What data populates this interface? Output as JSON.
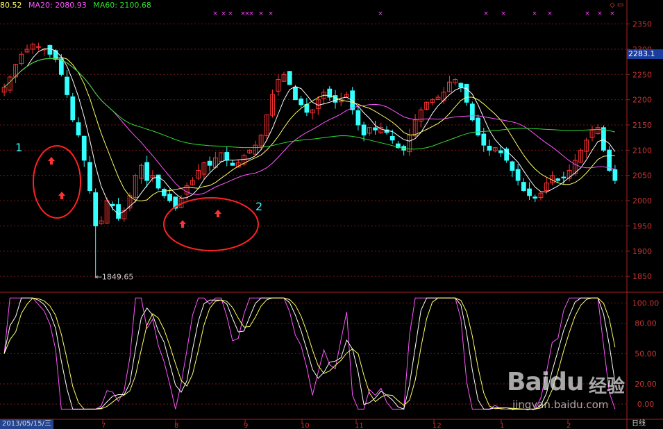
{
  "header": {
    "ma_items": [
      {
        "label": "80.52",
        "color": "#ffff66"
      },
      {
        "label": "MA20: 2080.93",
        "color": "#ff55ff"
      },
      {
        "label": "MA60: 2100.68",
        "color": "#33dd33"
      }
    ],
    "current_price": "2283.1",
    "corner_icons": "◇ ▭"
  },
  "footer": {
    "date_label": "2013/05/15/三",
    "period_label": "日线"
  },
  "annotations": {
    "label_1": "1",
    "label_2": "2",
    "low_label": "←1849.65"
  },
  "watermark": {
    "logo": "Baidu",
    "cn": "经验",
    "url": "jingyan.baidu.com"
  },
  "chart_data": [
    {
      "type": "candlestick",
      "y_ticks": [
        2350,
        2300,
        2250,
        2200,
        2150,
        2100,
        2050,
        2000,
        1950,
        1900,
        1850
      ],
      "y_tick_labels": [
        "2350",
        "2300",
        "2250",
        "2200",
        "2150",
        "2100",
        "2050",
        "2000",
        "1950",
        "1900",
        "1850"
      ],
      "ylim": [
        1820,
        2370
      ],
      "x_tick_labels": [
        "7",
        "8",
        "9",
        "10",
        "11",
        "12",
        "1",
        "2"
      ],
      "close_series": [
        2225,
        2245,
        2270,
        2290,
        2300,
        2310,
        2305,
        2300,
        2290,
        2280,
        2250,
        2210,
        2160,
        2130,
        2080,
        2020,
        1950,
        1960,
        2000,
        1990,
        1965,
        1980,
        2010,
        2050,
        2070,
        2040,
        2050,
        2025,
        2010,
        2000,
        1985,
        2005,
        2030,
        2040,
        2060,
        2075,
        2070,
        2085,
        2095,
        2080,
        2070,
        2075,
        2090,
        2100,
        2110,
        2130,
        2170,
        2210,
        2240,
        2250,
        2230,
        2200,
        2190,
        2175,
        2180,
        2200,
        2215,
        2205,
        2195,
        2200,
        2210,
        2180,
        2150,
        2130,
        2145,
        2140,
        2145,
        2135,
        2120,
        2105,
        2100,
        2130,
        2160,
        2180,
        2195,
        2200,
        2205,
        2215,
        2235,
        2240,
        2225,
        2195,
        2160,
        2130,
        2110,
        2100,
        2105,
        2095,
        2080,
        2060,
        2040,
        2020,
        2010,
        2005,
        2015,
        2035,
        2050,
        2040,
        2045,
        2060,
        2080,
        2100,
        2120,
        2140,
        2145,
        2100,
        2060,
        2040
      ],
      "low_label_value": 1849.65,
      "ma_lines": [
        {
          "name": "MA20",
          "color": "#ff55ff"
        },
        {
          "name": "MA60",
          "color": "#33dd33"
        }
      ]
    },
    {
      "type": "line",
      "y_ticks": [
        100,
        80,
        50,
        20,
        0
      ],
      "y_tick_labels": [
        "100.00",
        "80.00",
        "50.00",
        "20.00",
        "0.00"
      ],
      "ylim": [
        -15,
        110
      ],
      "series": [
        {
          "color": "#ff55ff"
        },
        {
          "color": "#ffffff"
        },
        {
          "color": "#ffff66"
        }
      ]
    }
  ],
  "colors": {
    "up": "#ff3333",
    "down": "#33ffff",
    "grid": "#7a1a1a",
    "axis": "#aa2222",
    "annotation_circle": "#ff2222",
    "annotation_label": "#33ffff"
  }
}
